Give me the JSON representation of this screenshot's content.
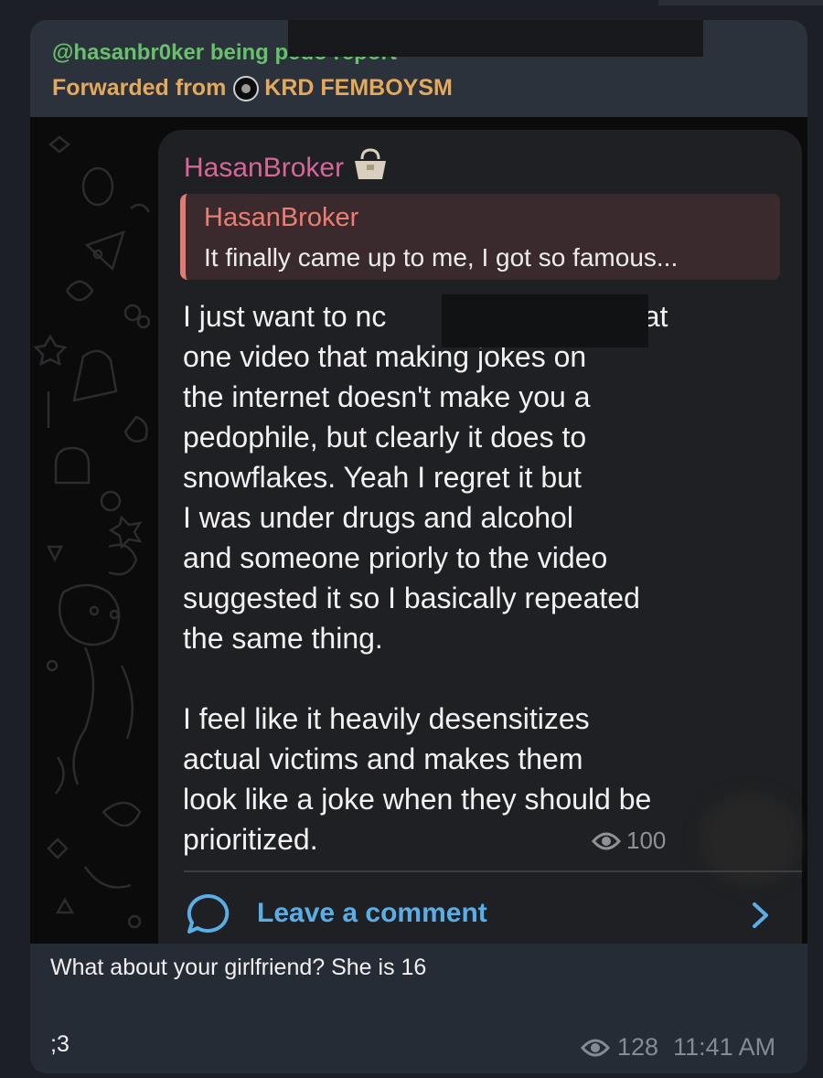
{
  "message": {
    "sender": "@hasanbr0ker being pedo report",
    "forwarded_prefix": "Forwarded from",
    "forwarded_channel": "KRD FEMBOYSM",
    "caption": "What about your girlfriend? She is 16",
    "caption_line2": ";3",
    "views": "128",
    "time": "11:41 AM"
  },
  "screenshot": {
    "author": "HasanBroker",
    "reply": {
      "name": "HasanBroker",
      "text": "It finally came up to me, I got so famous..."
    },
    "lines": [
      "I just want to nc",
      "one video that making jokes on",
      "the internet doesn't make you a",
      "pedophile, but clearly it does to",
      "snowflakes. Yeah I regret it but",
      "I was under drugs and alcohol",
      "and someone priorly to the video",
      "suggested it so I basically repeated",
      "the same thing."
    ],
    "line1_tail": "that",
    "lines2": [
      "I feel like it heavily desensitizes",
      "actual victims and makes them",
      "look like a joke when they should be",
      "prioritized."
    ],
    "views": "100",
    "comment_label": "Leave a comment"
  },
  "colors": {
    "sender": "#68c06c",
    "forwarded": "#e5a95c",
    "inner_name": "#d8669a",
    "reply_accent": "#e07a72",
    "link": "#5aaee8"
  },
  "icons": [
    "eye-icon",
    "comment-bubble-icon",
    "chevron-right-icon",
    "handbag-icon",
    "channel-avatar"
  ]
}
